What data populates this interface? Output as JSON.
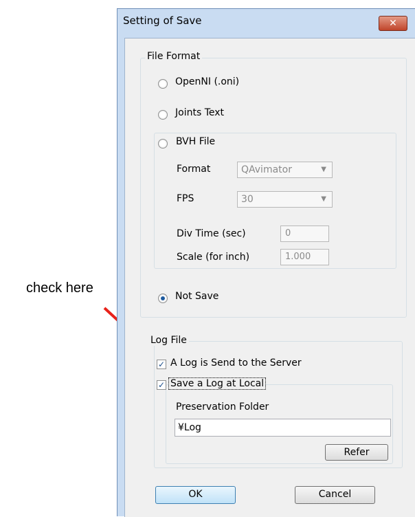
{
  "annotation": {
    "text": "check here"
  },
  "dialog": {
    "title": "Setting of Save",
    "close_label": "✕"
  },
  "file_format": {
    "legend": "File Format",
    "options": [
      "OpenNI (.oni)",
      "Joints Text",
      "BVH File",
      "Not Save"
    ],
    "selected": "Not Save",
    "bvh": {
      "format_label": "Format",
      "format_value": "QAvimator",
      "fps_label": "FPS",
      "fps_value": "30",
      "div_time_label": "Div Time (sec)",
      "div_time_value": "0",
      "scale_label": "Scale (for inch)",
      "scale_value": "1.000"
    }
  },
  "log_file": {
    "legend": "Log File",
    "send_server_label": "A Log is Send to the Server",
    "send_server_checked": true,
    "save_local_label": "Save a Log at Local",
    "save_local_checked": true,
    "folder_label": "Preservation Folder",
    "folder_value": "¥Log",
    "refer_label": "Refer"
  },
  "buttons": {
    "ok": "OK",
    "cancel": "Cancel"
  },
  "colors": {
    "selection": "#1d5a9e",
    "check": "#1d4f8c",
    "arrow": "#e8221a",
    "close": "#c0452b"
  }
}
